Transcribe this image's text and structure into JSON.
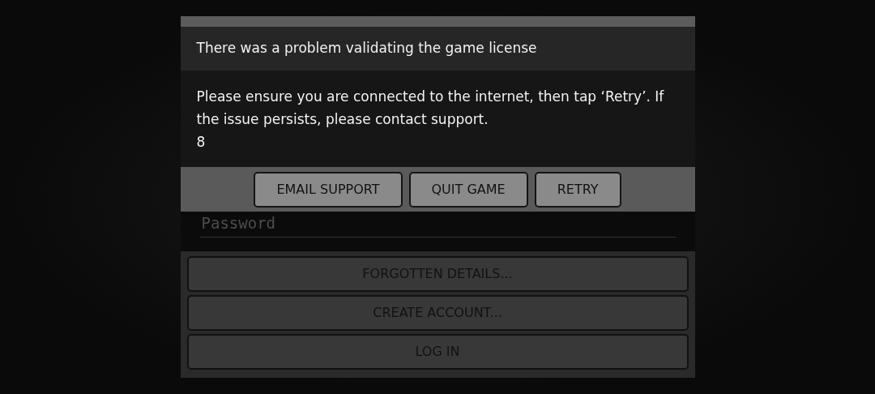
{
  "dialog": {
    "title": "There was a problem validating the game license",
    "message": "Please ensure you are connected to the internet, then tap ‘Retry’. If the issue persists, please contact support.",
    "code": "8",
    "buttons": [
      "EMAIL SUPPORT",
      "QUIT GAME",
      "RETRY"
    ]
  },
  "login": {
    "password": {
      "placeholder": "Password"
    },
    "buttons": [
      "FORGOTTEN DETAILS...",
      "CREATE ACCOUNT...",
      "LOG IN"
    ]
  }
}
